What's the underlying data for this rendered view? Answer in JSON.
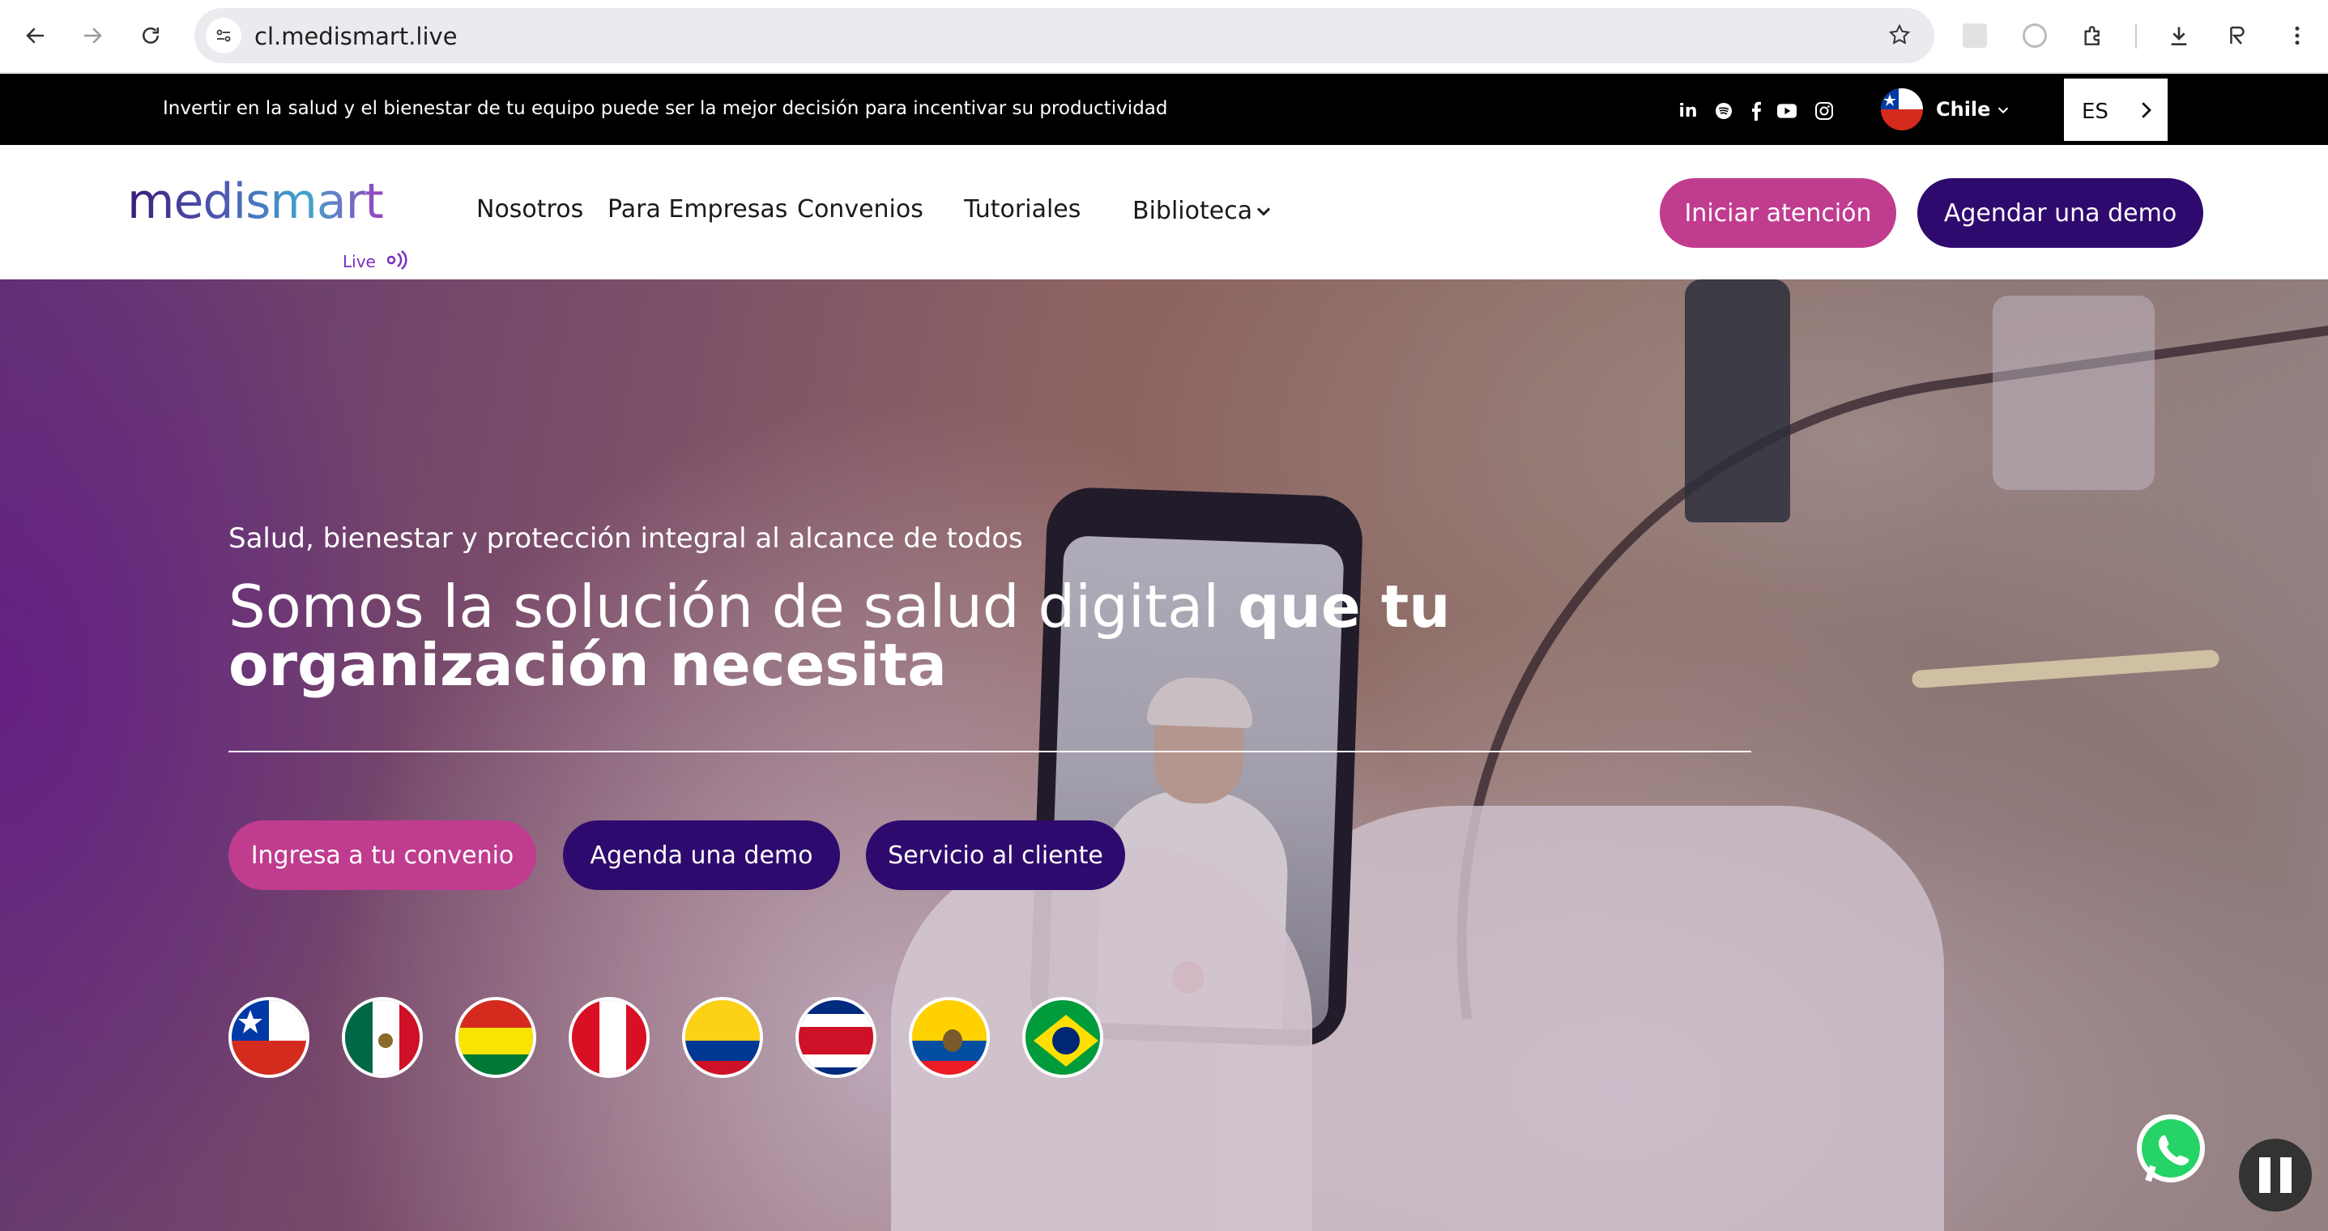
{
  "browser": {
    "url": "cl.medismart.live"
  },
  "topbar": {
    "message": "Invertir en la salud y el bienestar de tu equipo puede ser la mejor decisión para incentivar su productividad",
    "country": "Chile",
    "language": "ES"
  },
  "header": {
    "logo_main": "medismart",
    "logo_sub": "Live",
    "menu": [
      {
        "label": "Nosotros"
      },
      {
        "label": "Para Empresas"
      },
      {
        "label": "Convenios"
      },
      {
        "label": "Tutoriales"
      },
      {
        "label": "Biblioteca"
      }
    ],
    "cta_primary": "Iniciar atención",
    "cta_secondary": "Agendar una demo"
  },
  "hero": {
    "subtitle": "Salud, bienestar y protección integral al alcance de todos",
    "title_regular": "Somos la solución de salud digital ",
    "title_bold": "que tu organización necesita",
    "buttons": [
      {
        "label": "Ingresa a tu convenio"
      },
      {
        "label": "Agenda una demo"
      },
      {
        "label": "Servicio al cliente"
      }
    ],
    "flags": [
      "chile-flag",
      "mexico-flag",
      "bolivia-flag",
      "peru-flag",
      "colombia-flag",
      "costa-rica-flag",
      "ecuador-flag",
      "brazil-flag"
    ]
  },
  "colors": {
    "brand_pink": "#c03c8f",
    "brand_purple": "#2e0a6e",
    "topbar_bg": "#000000"
  }
}
